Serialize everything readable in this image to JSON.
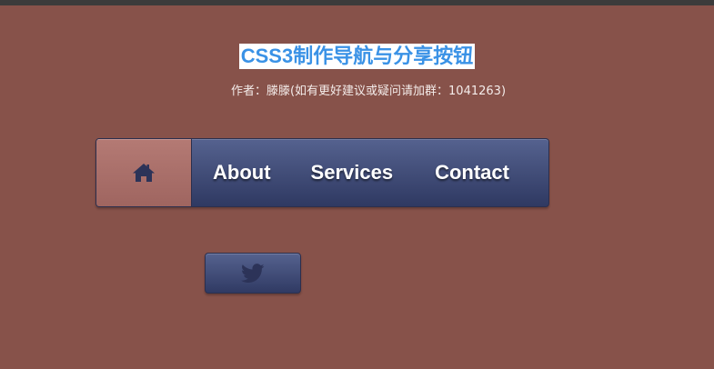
{
  "header": {
    "title": "CSS3制作导航与分享按钮",
    "subtitle": "作者：滕滕(如有更好建议或疑问请加群：1041263)"
  },
  "nav": {
    "home_icon": "home-icon",
    "items": [
      {
        "label": "About"
      },
      {
        "label": "Services"
      },
      {
        "label": "Contact"
      }
    ]
  },
  "share": {
    "icon": "twitter-icon"
  },
  "colors": {
    "background": "#87524a",
    "title_text": "#3a92e6",
    "nav_gradient_top": "#55628f",
    "nav_gradient_bottom": "#2f3962",
    "home_active": "#b47a74",
    "icon_dark": "#2c3358"
  }
}
